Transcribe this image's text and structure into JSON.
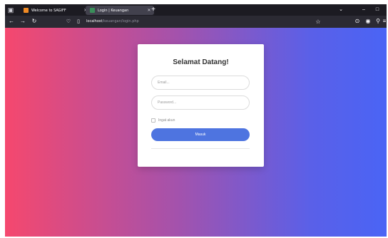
{
  "browser": {
    "tabs": [
      {
        "title": "Welcome to SAGIFF",
        "favicon_color": "#f08a24"
      },
      {
        "title": "Login | Keuangan",
        "favicon_color": "#3a8f5a"
      }
    ],
    "new_tab_symbol": "+",
    "window_controls": {
      "list": "⌄",
      "minimize": "–",
      "restore": "□"
    },
    "url_host": "localhost",
    "url_path": "/keuangan/login.php",
    "icons": {
      "tab_list": "tab-list-icon",
      "back": "arrow-left-icon",
      "forward": "arrow-right-icon",
      "reload": "reload-icon",
      "shield": "shield-icon",
      "page_info": "page-icon",
      "bookmark": "star-icon",
      "pocket": "pocket-icon",
      "account": "account-icon",
      "extensions": "extensions-icon",
      "menu": "menu-icon"
    }
  },
  "page": {
    "gradient_start": "#f5486e",
    "gradient_end": "#4a64f5",
    "login": {
      "title": "Selamat Datang!",
      "email_placeholder": "Email...",
      "password_placeholder": "Password...",
      "remember_label": "Ingat akun",
      "submit_label": "Masuk",
      "button_color": "#4e74e0"
    }
  }
}
